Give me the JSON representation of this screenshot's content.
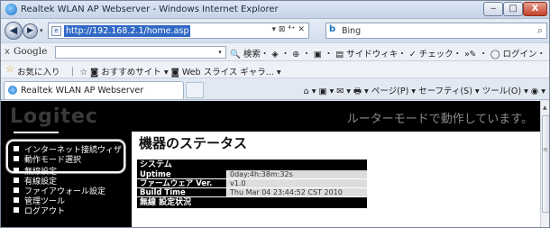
{
  "window": {
    "title": "Realtek WLAN AP Webserver - Windows Internet Explorer",
    "min": "‒",
    "max": "□",
    "close": "X"
  },
  "nav": {
    "back": "◀",
    "forward": "▶",
    "dropdown": "▾",
    "url": "http://192.168.2.1/home.asp",
    "addr_controls": "▾ ⊠ ⁴⁺ ✕",
    "stop": "✕",
    "search_provider": "Bing",
    "search_icon": "⌕"
  },
  "google_bar": {
    "close": "x",
    "logo": "Google",
    "dropdown": "▾",
    "items": "🔍 検索・ ◈ ・ ⊕ ・ ▣ ・ ▤ サイドウィキ・ ✓ チェック・ »",
    "right": "✎ ・ ◯ ログイン・"
  },
  "favorites_bar": {
    "star": "☆",
    "label": "お気に入り",
    "items": "｜ ☆ ◙ おすすめサイト ▾  ◙ Web スライス ギャラ... ▾"
  },
  "tabs": {
    "active": "Realtek WLAN AP Webserver",
    "commands": "⌂ ▾ ▣ ▾ ✉ ▾ 🖶 ▾ ページ(P) ▾ セーフティ(S) ▾ ツール(O) ▾ ◉ ▾"
  },
  "page": {
    "logo": "Logitec",
    "slogan": "ルーターモードで動作しています。",
    "title": "機器のステータス",
    "menu": [
      "インターネット接続ウィザ",
      "動作モード選択",
      "無線設定",
      "有線設定",
      "ファイアウォール設定",
      "管理ツール",
      "ログアウト"
    ],
    "system": {
      "header": "システム",
      "rows": [
        {
          "key": "Uptime",
          "value": "0day:4h:38m:32s"
        },
        {
          "key": "ファームウェア Ver.",
          "value": "v1.0"
        },
        {
          "key": "Build Time",
          "value": "Thu Mar 04 23:44:52 CST 2010"
        }
      ],
      "next_header": "無線 設定状況"
    }
  },
  "colors": {
    "banner": "#000000",
    "url_highlight": "#3169c6",
    "close_button": "#c3412a"
  }
}
